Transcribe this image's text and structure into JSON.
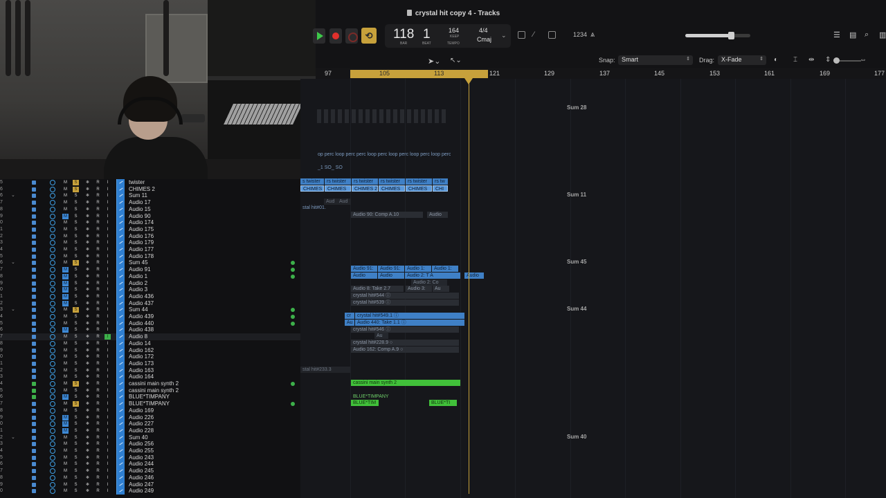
{
  "window": {
    "title": "crystal hit  copy 4 - Tracks"
  },
  "transport": {
    "bar": "118",
    "beat": "1",
    "bar_label": "BAR",
    "beat_label": "BEAT",
    "tempo": "164",
    "tempo_mode": "KEEP",
    "tempo_label": "TEMPO",
    "time_signature": "4/4",
    "key": "Cmaj",
    "count_in": "1234",
    "cycle_symbol": "⟲",
    "master_volume_fraction": 0.7
  },
  "toolbar": {
    "snap_label": "Snap:",
    "snap_value": "Smart",
    "drag_label": "Drag:",
    "drag_value": "X-Fade"
  },
  "ruler": {
    "numbers": [
      "97",
      "105",
      "113",
      "121",
      "129",
      "137",
      "145",
      "153",
      "161",
      "169",
      "177"
    ],
    "cycle_start": "105",
    "cycle_end": "121",
    "playhead_bar": "118"
  },
  "arrange": {
    "sum_labels": [
      "Sum 28",
      "Sum 11",
      "Sum 45",
      "Sum 44",
      "Sum 40"
    ],
    "regions": [
      {
        "text": "op  perc loop  perc  perc loop  perc loop  perc loop  perc loop  perc loop"
      },
      {
        "text": "_1  SO_  SO"
      },
      {
        "text": "s twister"
      },
      {
        "text": "rs twister"
      },
      {
        "text": "rs twister"
      },
      {
        "text": "rs twister"
      },
      {
        "text": "rs twister"
      },
      {
        "text": "rs tw"
      },
      {
        "text": "CHIMES"
      },
      {
        "text": "CHIMES"
      },
      {
        "text": "CHIMES 2"
      },
      {
        "text": "CHIMES"
      },
      {
        "text": "CHIMES"
      },
      {
        "text": "CHI"
      },
      {
        "text": "Aud"
      },
      {
        "text": "Aud"
      },
      {
        "text": "stal hit#01."
      },
      {
        "text": "Audio 90: Comp A.10"
      },
      {
        "text": "Audio"
      },
      {
        "text": "Audio 91:"
      },
      {
        "text": "Audio 91:"
      },
      {
        "text": "Audio 1:"
      },
      {
        "text": "Audio 1:"
      },
      {
        "text": "Audio"
      },
      {
        "text": "Audio"
      },
      {
        "text": "Audio 2: T  A"
      },
      {
        "text": "Audio"
      },
      {
        "text": "Audio 2: Co"
      },
      {
        "text": "Audio 8: Take 2.7"
      },
      {
        "text": "Audio 3:"
      },
      {
        "text": "Au"
      },
      {
        "text": "crystal hit#544 ⓘ"
      },
      {
        "text": "crystal hit#539 ⓘ"
      },
      {
        "text": "cr"
      },
      {
        "text": "crystal hit#549.1 ⓘ"
      },
      {
        "text": "Au"
      },
      {
        "text": "Audio 440: Take 1.1 ⓘ"
      },
      {
        "text": "crystal hit#546 ⓘ"
      },
      {
        "text": "Au"
      },
      {
        "text": "crystal hit#228.9 ○"
      },
      {
        "text": "Audio 162: Comp A.9 ○"
      },
      {
        "text": "stal hit#233.3"
      },
      {
        "text": "cassini main synth 2"
      },
      {
        "text": "BLUE*TIMPANY"
      },
      {
        "text": "BLUE*TIM"
      },
      {
        "text": "BLUE*TI"
      }
    ]
  },
  "tracks": [
    {
      "num": "5",
      "name": "twister",
      "m": false,
      "s": true,
      "input": false,
      "dot": false,
      "green": false
    },
    {
      "num": "6",
      "name": "CHIMES 2",
      "m": false,
      "s": true,
      "input": false,
      "dot": false,
      "green": false
    },
    {
      "num": "6",
      "name": "Sum 11",
      "m": false,
      "s": false,
      "input": false,
      "dot": false,
      "green": false
    },
    {
      "num": "7",
      "name": "Audio 17",
      "m": false,
      "s": false,
      "input": false,
      "dot": false,
      "green": false
    },
    {
      "num": "8",
      "name": "Audio 15",
      "m": false,
      "s": false,
      "input": false,
      "dot": false,
      "green": false
    },
    {
      "num": "9",
      "name": "Audio 90",
      "m": true,
      "s": false,
      "input": false,
      "dot": false,
      "green": false
    },
    {
      "num": "0",
      "name": "Audio 174",
      "m": false,
      "s": false,
      "input": false,
      "dot": false,
      "green": false
    },
    {
      "num": "1",
      "name": "Audio 175",
      "m": false,
      "s": false,
      "input": false,
      "dot": false,
      "green": false
    },
    {
      "num": "2",
      "name": "Audio 176",
      "m": false,
      "s": false,
      "input": false,
      "dot": false,
      "green": false
    },
    {
      "num": "3",
      "name": "Audio 179",
      "m": false,
      "s": false,
      "input": false,
      "dot": false,
      "green": false
    },
    {
      "num": "4",
      "name": "Audio 177",
      "m": false,
      "s": false,
      "input": false,
      "dot": false,
      "green": false
    },
    {
      "num": "5",
      "name": "Audio 178",
      "m": false,
      "s": false,
      "input": false,
      "dot": false,
      "green": false
    },
    {
      "num": "6",
      "name": "Sum 45",
      "m": false,
      "s": true,
      "input": false,
      "dot": true,
      "green": false
    },
    {
      "num": "7",
      "name": "Audio 91",
      "m": true,
      "s": false,
      "input": false,
      "dot": true,
      "green": false
    },
    {
      "num": "8",
      "name": "Audio 1",
      "m": true,
      "s": false,
      "input": false,
      "dot": true,
      "green": false
    },
    {
      "num": "9",
      "name": "Audio 2",
      "m": true,
      "s": false,
      "input": false,
      "dot": false,
      "green": false
    },
    {
      "num": "0",
      "name": "Audio 3",
      "m": true,
      "s": false,
      "input": false,
      "dot": false,
      "green": false
    },
    {
      "num": "1",
      "name": "Audio 436",
      "m": true,
      "s": false,
      "input": false,
      "dot": false,
      "green": false
    },
    {
      "num": "2",
      "name": "Audio 437",
      "m": true,
      "s": false,
      "input": false,
      "dot": false,
      "green": false
    },
    {
      "num": "3",
      "name": "Sum 44",
      "m": false,
      "s": true,
      "input": false,
      "dot": true,
      "green": false
    },
    {
      "num": "4",
      "name": "Audio 439",
      "m": false,
      "s": false,
      "input": false,
      "dot": true,
      "green": false
    },
    {
      "num": "5",
      "name": "Audio 440",
      "m": false,
      "s": false,
      "input": false,
      "dot": true,
      "green": false
    },
    {
      "num": "6",
      "name": "Audio 438",
      "m": true,
      "s": false,
      "input": false,
      "dot": false,
      "green": false
    },
    {
      "num": "7",
      "name": "Audio 8",
      "m": false,
      "s": false,
      "input": true,
      "dot": false,
      "green": false
    },
    {
      "num": "8",
      "name": "Audio 14",
      "m": false,
      "s": false,
      "input": false,
      "dot": false,
      "green": false
    },
    {
      "num": "9",
      "name": "Audio 162",
      "m": false,
      "s": false,
      "input": false,
      "dot": false,
      "green": false
    },
    {
      "num": "0",
      "name": "Audio 172",
      "m": false,
      "s": false,
      "input": false,
      "dot": false,
      "green": false
    },
    {
      "num": "1",
      "name": "Audio 173",
      "m": false,
      "s": false,
      "input": false,
      "dot": false,
      "green": false
    },
    {
      "num": "2",
      "name": "Audio 163",
      "m": false,
      "s": false,
      "input": false,
      "dot": false,
      "green": false
    },
    {
      "num": "3",
      "name": "Audio 164",
      "m": false,
      "s": false,
      "input": false,
      "dot": false,
      "green": false
    },
    {
      "num": "4",
      "name": "cassini main synth 2",
      "m": false,
      "s": true,
      "input": false,
      "dot": true,
      "green": true
    },
    {
      "num": "5",
      "name": "cassini main synth 2",
      "m": false,
      "s": false,
      "input": false,
      "dot": false,
      "green": true
    },
    {
      "num": "6",
      "name": "BLUE*TIMPANY",
      "m": true,
      "s": false,
      "input": false,
      "dot": false,
      "green": true
    },
    {
      "num": "7",
      "name": "BLUE*TIMPANY",
      "m": false,
      "s": true,
      "input": false,
      "dot": true,
      "green": false
    },
    {
      "num": "8",
      "name": "Audio 169",
      "m": false,
      "s": false,
      "input": false,
      "dot": false,
      "green": false
    },
    {
      "num": "9",
      "name": "Audio 226",
      "m": true,
      "s": false,
      "input": false,
      "dot": false,
      "green": false
    },
    {
      "num": "0",
      "name": "Audio 227",
      "m": true,
      "s": false,
      "input": false,
      "dot": false,
      "green": false
    },
    {
      "num": "1",
      "name": "Audio 228",
      "m": true,
      "s": false,
      "input": false,
      "dot": false,
      "green": false
    },
    {
      "num": "2",
      "name": "Sum 40",
      "m": false,
      "s": false,
      "input": false,
      "dot": false,
      "green": false
    },
    {
      "num": "3",
      "name": "Audio 256",
      "m": false,
      "s": false,
      "input": false,
      "dot": false,
      "green": false
    },
    {
      "num": "4",
      "name": "Audio 255",
      "m": false,
      "s": false,
      "input": false,
      "dot": false,
      "green": false
    },
    {
      "num": "5",
      "name": "Audio 243",
      "m": false,
      "s": false,
      "input": false,
      "dot": false,
      "green": false
    },
    {
      "num": "6",
      "name": "Audio 244",
      "m": false,
      "s": false,
      "input": false,
      "dot": false,
      "green": false
    },
    {
      "num": "7",
      "name": "Audio 245",
      "m": false,
      "s": false,
      "input": false,
      "dot": false,
      "green": false
    },
    {
      "num": "8",
      "name": "Audio 246",
      "m": false,
      "s": false,
      "input": false,
      "dot": false,
      "green": false
    },
    {
      "num": "9",
      "name": "Audio 247",
      "m": false,
      "s": false,
      "input": false,
      "dot": false,
      "green": false
    },
    {
      "num": "0",
      "name": "Audio 249",
      "m": false,
      "s": false,
      "input": false,
      "dot": false,
      "green": false
    }
  ],
  "button_letters": {
    "mute": "M",
    "solo": "S",
    "freeze": "❄",
    "record": "R",
    "input": "I"
  },
  "colors": {
    "accent_gold": "#c7a13b",
    "region_blue": "#3f80c6",
    "region_green": "#41c03a",
    "play_green": "#3ec94a",
    "record_red": "#e0302c"
  }
}
